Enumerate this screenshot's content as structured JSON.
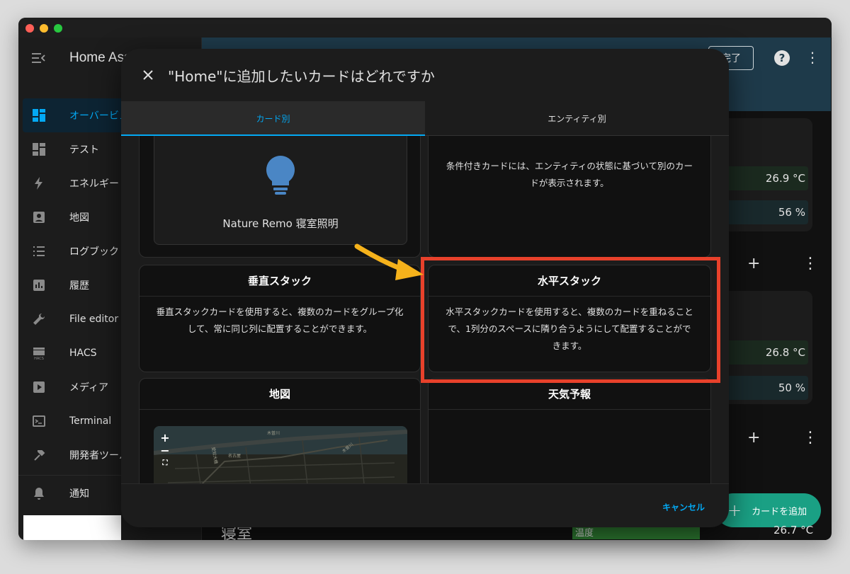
{
  "window": {
    "traffic_lights": [
      "close",
      "minimize",
      "zoom"
    ]
  },
  "sidebar": {
    "title": "Home Assistant",
    "items": [
      {
        "label": "オーバービュー",
        "icon": "dashboard-icon",
        "active": true
      },
      {
        "label": "テスト",
        "icon": "dashboard-icon",
        "active": false
      },
      {
        "label": "エネルギー",
        "icon": "lightning-icon",
        "active": false
      },
      {
        "label": "地図",
        "icon": "map-icon",
        "active": false
      },
      {
        "label": "ログブック",
        "icon": "list-icon",
        "active": false
      },
      {
        "label": "履歴",
        "icon": "chart-icon",
        "active": false
      },
      {
        "label": "File editor",
        "icon": "wrench-icon",
        "active": false
      },
      {
        "label": "HACS",
        "icon": "store-icon",
        "active": false
      },
      {
        "label": "メディア",
        "icon": "play-icon",
        "active": false
      },
      {
        "label": "Terminal",
        "icon": "terminal-icon",
        "active": false
      },
      {
        "label": "開発者ツール",
        "icon": "hammer-icon",
        "active": false
      }
    ],
    "notifications": {
      "label": "通知",
      "icon": "bell-icon"
    }
  },
  "appbar": {
    "done_label": "完了",
    "help_icon": "help-icon",
    "more_icon": "more-icon"
  },
  "dashboard": {
    "values": [
      "26.9 °C",
      "56 %",
      "26.8 °C",
      "50 %"
    ],
    "section_title": "寝室",
    "temp_label": "温度",
    "temp_value": "26.7 °C",
    "add_card_label": "カードを追加"
  },
  "dialog": {
    "title": "\"Home\"に追加したいカードはどれですか",
    "tabs": [
      {
        "label": "カード別",
        "active": true
      },
      {
        "label": "エンティティ別",
        "active": false
      }
    ],
    "cards": {
      "entity_preview": {
        "entity_name": "Nature Remo 寝室照明"
      },
      "conditional": {
        "description": "条件付きカードには、エンティティの状態に基づいて別のカードが表示されます。"
      },
      "vertical_stack": {
        "title": "垂直スタック",
        "description": "垂直スタックカードを使用すると、複数のカードをグループ化して、常に同じ列に配置することができます。"
      },
      "horizontal_stack": {
        "title": "水平スタック",
        "description": "水平スタックカードを使用すると、複数のカードを重ねることで、1列分のスペースに隣り合うようにして配置することができます。"
      },
      "map": {
        "title": "地図",
        "map_labels": [
          "木曽川",
          "愛知大橋",
          "名古屋",
          "木曽川"
        ],
        "controls": {
          "zoom_in": "+",
          "zoom_out": "−"
        }
      },
      "weather": {
        "title": "天気予報"
      }
    },
    "cancel_label": "キャンセル"
  },
  "colors": {
    "accent": "#03a9f4",
    "highlight": "#e8412b",
    "arrow": "#f5b21b",
    "fab": "#1aa084"
  }
}
